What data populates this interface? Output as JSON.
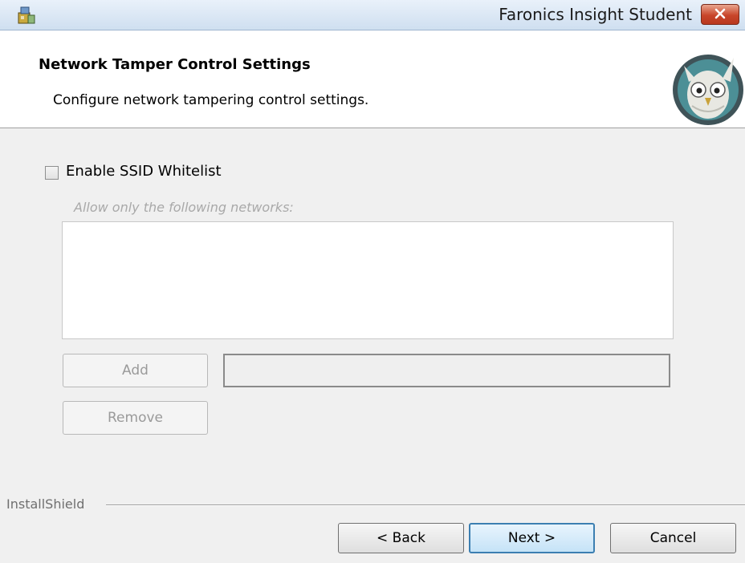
{
  "window": {
    "title": "Faronics Insight Student",
    "close_icon": "close-icon",
    "app_icon": "installer-icon"
  },
  "header": {
    "title": "Network Tamper Control Settings",
    "subtitle": "Configure network tampering control settings.",
    "logo": "owl-logo"
  },
  "ssid": {
    "checkbox_label": "Enable SSID Whitelist",
    "checked": false,
    "allow_label": "Allow only the following networks:",
    "networks": [],
    "add_label": "Add",
    "remove_label": "Remove",
    "network_input_value": ""
  },
  "footer": {
    "brand": "InstallShield",
    "back_label": "< Back",
    "next_label": "Next >",
    "cancel_label": "Cancel"
  },
  "colors": {
    "close_button": "#c8452a",
    "default_button_border": "#3c7fb1",
    "dialog_background": "#f0f0f0",
    "disabled_text": "#9a9a9a"
  }
}
